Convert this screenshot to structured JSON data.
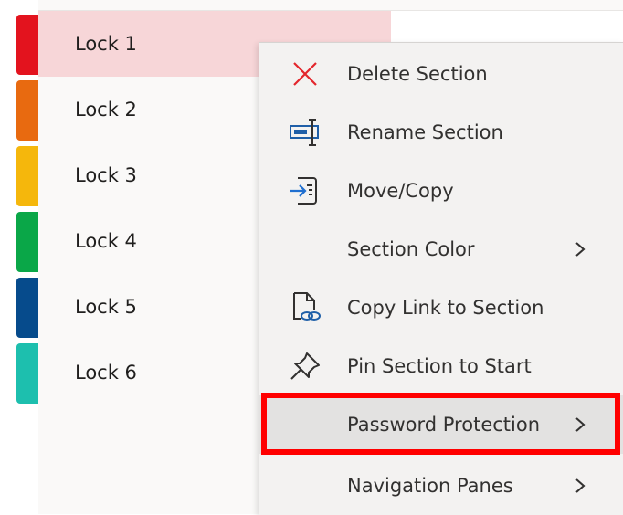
{
  "sections": {
    "items": [
      {
        "label": "Lock 1",
        "color": "#e3131e"
      },
      {
        "label": "Lock 2",
        "color": "#e86a10"
      },
      {
        "label": "Lock 3",
        "color": "#f5b70c"
      },
      {
        "label": "Lock 4",
        "color": "#0aa748"
      },
      {
        "label": "Lock 5",
        "color": "#064b8c"
      },
      {
        "label": "Lock 6",
        "color": "#1dbfae"
      }
    ],
    "selected_index": 0,
    "selected_bg": "#f7d6d8"
  },
  "context_menu": {
    "items": [
      {
        "label": "Delete Section",
        "icon": "close-x-icon",
        "submenu": false
      },
      {
        "label": "Rename Section",
        "icon": "rename-cursor-icon",
        "submenu": false
      },
      {
        "label": "Move/Copy",
        "icon": "move-copy-icon",
        "submenu": false
      },
      {
        "label": "Section Color",
        "icon": "",
        "submenu": true
      },
      {
        "label": "Copy Link to Section",
        "icon": "copy-link-icon",
        "submenu": false
      },
      {
        "label": "Pin Section to Start",
        "icon": "pin-icon",
        "submenu": false
      },
      {
        "label": "Password Protection",
        "icon": "",
        "submenu": true
      },
      {
        "label": "Navigation Panes",
        "icon": "",
        "submenu": true
      }
    ],
    "hovered_index": 6,
    "highlight_color": "#ff0000"
  }
}
